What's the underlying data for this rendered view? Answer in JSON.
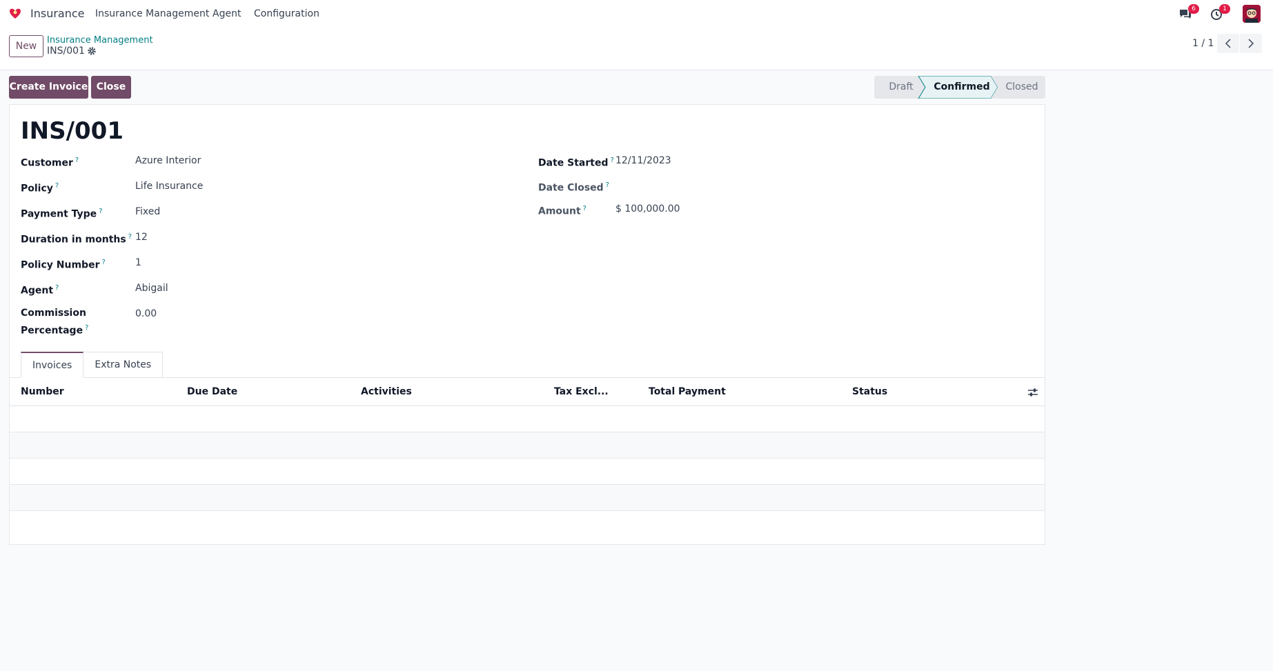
{
  "navbar": {
    "app_name": "Insurance",
    "menus": [
      "Insurance Management",
      "Agent",
      "Configuration"
    ],
    "messages_count": "6",
    "activities_count": "1"
  },
  "control": {
    "new_label": "New",
    "breadcrumb_parent": "Insurance Management",
    "breadcrumb_current": "INS/001",
    "pager": "1 / 1"
  },
  "actions": {
    "create_invoice": "Create Invoice",
    "close": "Close"
  },
  "statusbar": {
    "stages": [
      "Draft",
      "Confirmed",
      "Closed"
    ],
    "current": "Confirmed"
  },
  "record": {
    "title": "INS/001",
    "left_fields": [
      {
        "label": "Customer",
        "value": "Azure Interior"
      },
      {
        "label": "Policy",
        "value": "Life Insurance"
      },
      {
        "label": "Payment Type",
        "value": "Fixed"
      },
      {
        "label": "Duration in months",
        "value": "12"
      },
      {
        "label": "Policy Number",
        "value": "1"
      },
      {
        "label": "Agent",
        "value": "Abigail"
      },
      {
        "label_line1": "Commission",
        "label_line2": "Percentage",
        "value": "0.00"
      }
    ],
    "right_fields": [
      {
        "label": "Date Started",
        "value": "12/11/2023"
      },
      {
        "label": "Date Closed",
        "value": ""
      },
      {
        "label": "Amount",
        "value": "$ 100,000.00"
      }
    ]
  },
  "tabs": [
    "Invoices",
    "Extra Notes"
  ],
  "table": {
    "columns": [
      "Number",
      "Due Date",
      "Activities",
      "Tax Excl...",
      "Total",
      "Payment",
      "Status"
    ],
    "rows": []
  },
  "colors": {
    "primary": "#714b67",
    "accent": "#017e84",
    "badge": "#e11d48"
  }
}
